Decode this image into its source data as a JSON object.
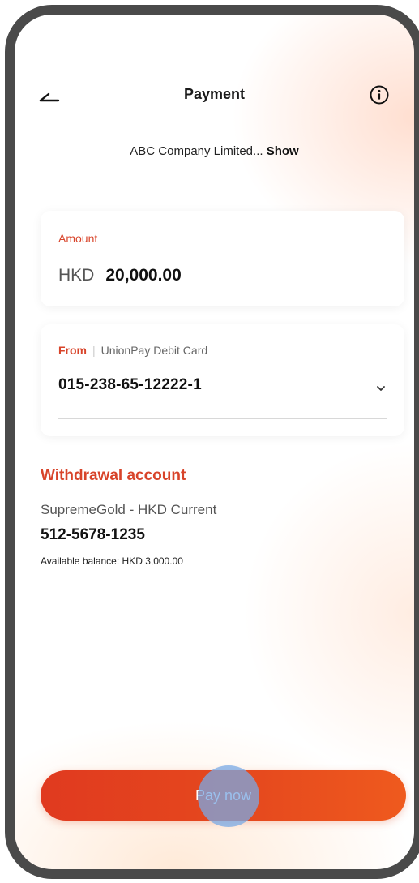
{
  "header": {
    "title": "Payment",
    "back_icon": "back-arrow-icon",
    "info_icon": "info-icon"
  },
  "merchant": {
    "name": "ABC Company Limited...",
    "show_label": "Show"
  },
  "amount": {
    "label": "Amount",
    "currency": "HKD",
    "value": "20,000.00"
  },
  "from": {
    "label": "From",
    "card_type": "UnionPay Debit Card",
    "card_number": "015-238-65-12222-1",
    "chevron_icon": "chevron-down-icon"
  },
  "withdrawal": {
    "title": "Withdrawal account",
    "account_name": "SupremeGold - HKD Current",
    "account_number": "512-5678-1235",
    "balance": "Available balance: HKD 3,000.00"
  },
  "actions": {
    "pay_label": "Pay now"
  },
  "colors": {
    "accent": "#d8442a",
    "button_start": "#e03a1f",
    "button_end": "#ef5a1e",
    "frame": "#4a4a4a"
  }
}
